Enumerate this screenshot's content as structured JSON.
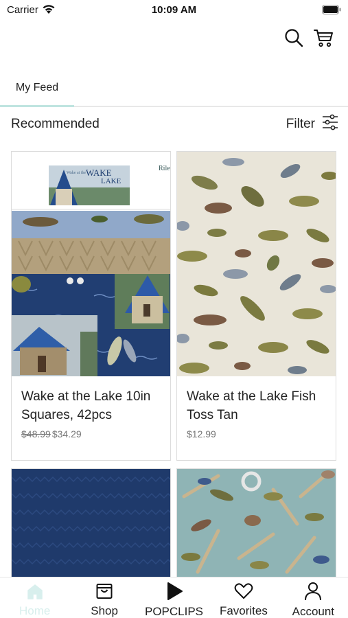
{
  "status_bar": {
    "carrier": "Carrier",
    "time": "10:09 AM"
  },
  "header": {
    "icons": [
      "search-icon",
      "cart-icon"
    ]
  },
  "tabs": [
    {
      "label": "My Feed",
      "active": true
    }
  ],
  "section": {
    "title": "Recommended",
    "filter_label": "Filter"
  },
  "products": [
    {
      "title": "Wake at the Lake 10in Squares, 42pcs",
      "price_old": "$48.99",
      "price": "$34.29",
      "image_text": {
        "small": "Wake at the",
        "big1": "WAKE",
        "big2": "LAKE",
        "brand": "Rile"
      }
    },
    {
      "title": "Wake at the Lake Fish Toss Tan",
      "price": "$12.99"
    },
    {
      "title": "",
      "image": "navy herringbone fabric"
    },
    {
      "title": "",
      "image": "teal oars and fish fabric"
    }
  ],
  "bottom_nav": [
    {
      "label": "Home",
      "icon": "home-icon",
      "active": true
    },
    {
      "label": "Shop",
      "icon": "shop-bag-icon",
      "active": false
    },
    {
      "label": "POPCLIPS",
      "icon": "play-icon",
      "active": false
    },
    {
      "label": "Favorites",
      "icon": "heart-icon",
      "active": false
    },
    {
      "label": "Account",
      "icon": "account-icon",
      "active": false
    }
  ],
  "colors": {
    "accent": "#bfe4e0",
    "home_active": "#d8efed",
    "navy_fabric": "#1f3a6b",
    "tan_fabric": "#e9e5d9",
    "teal_fabric": "#8fb4b5"
  }
}
